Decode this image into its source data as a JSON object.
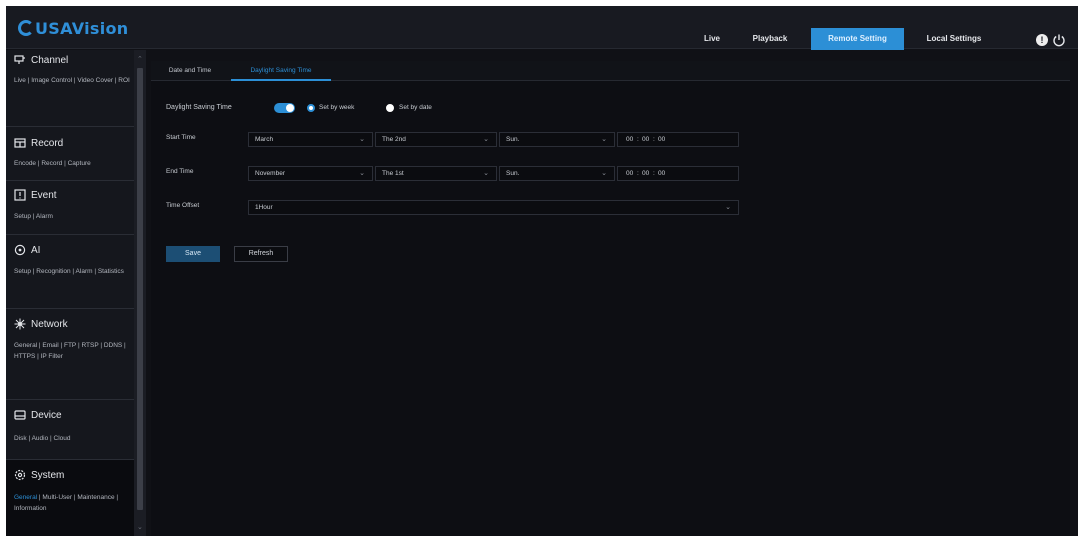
{
  "header": {
    "logo_text": "USAVision",
    "nav": [
      "Live",
      "Playback",
      "Remote Setting",
      "Local Settings"
    ],
    "active_nav": "Remote Setting",
    "help_icon": "!",
    "accent_color": "#2c8fd6"
  },
  "sidebar": {
    "sections": [
      {
        "title": "Channel",
        "icon": "channel-icon",
        "links": "Live | Image Control | Video Cover | ROI"
      },
      {
        "title": "Record",
        "icon": "record-icon",
        "links": "Encode | Record | Capture"
      },
      {
        "title": "Event",
        "icon": "event-icon",
        "links": "Setup | Alarm"
      },
      {
        "title": "AI",
        "icon": "ai-icon",
        "links": "Setup | Recognition | Alarm | Statistics"
      },
      {
        "title": "Network",
        "icon": "network-icon",
        "links": "General | Email | FTP | RTSP | DDNS | HTTPS | IP Filter"
      },
      {
        "title": "Device",
        "icon": "device-icon",
        "links": "Disk | Audio | Cloud"
      },
      {
        "title": "System",
        "icon": "system-icon",
        "links_highlight": "General",
        "links_rest": " | Multi-User | Maintenance | Information"
      }
    ]
  },
  "tabs": [
    "Date and Time",
    "Daylight Saving Time"
  ],
  "active_tab": "Daylight Saving Time",
  "form": {
    "dst_label": "Daylight Saving Time",
    "dst_enabled": true,
    "mode_week": "Set by week",
    "mode_date": "Set by date",
    "selected_mode": "Set by week",
    "start_label": "Start Time",
    "start_month": "March",
    "start_week": "The 2nd",
    "start_day": "Sun.",
    "start_hh": "00",
    "start_mm": "00",
    "start_ss": "00",
    "end_label": "End Time",
    "end_month": "November",
    "end_week": "The 1st",
    "end_day": "Sun.",
    "end_hh": "00",
    "end_mm": "00",
    "end_ss": "00",
    "offset_label": "Time Offset",
    "offset_value": "1Hour"
  },
  "buttons": {
    "save": "Save",
    "refresh": "Refresh"
  }
}
